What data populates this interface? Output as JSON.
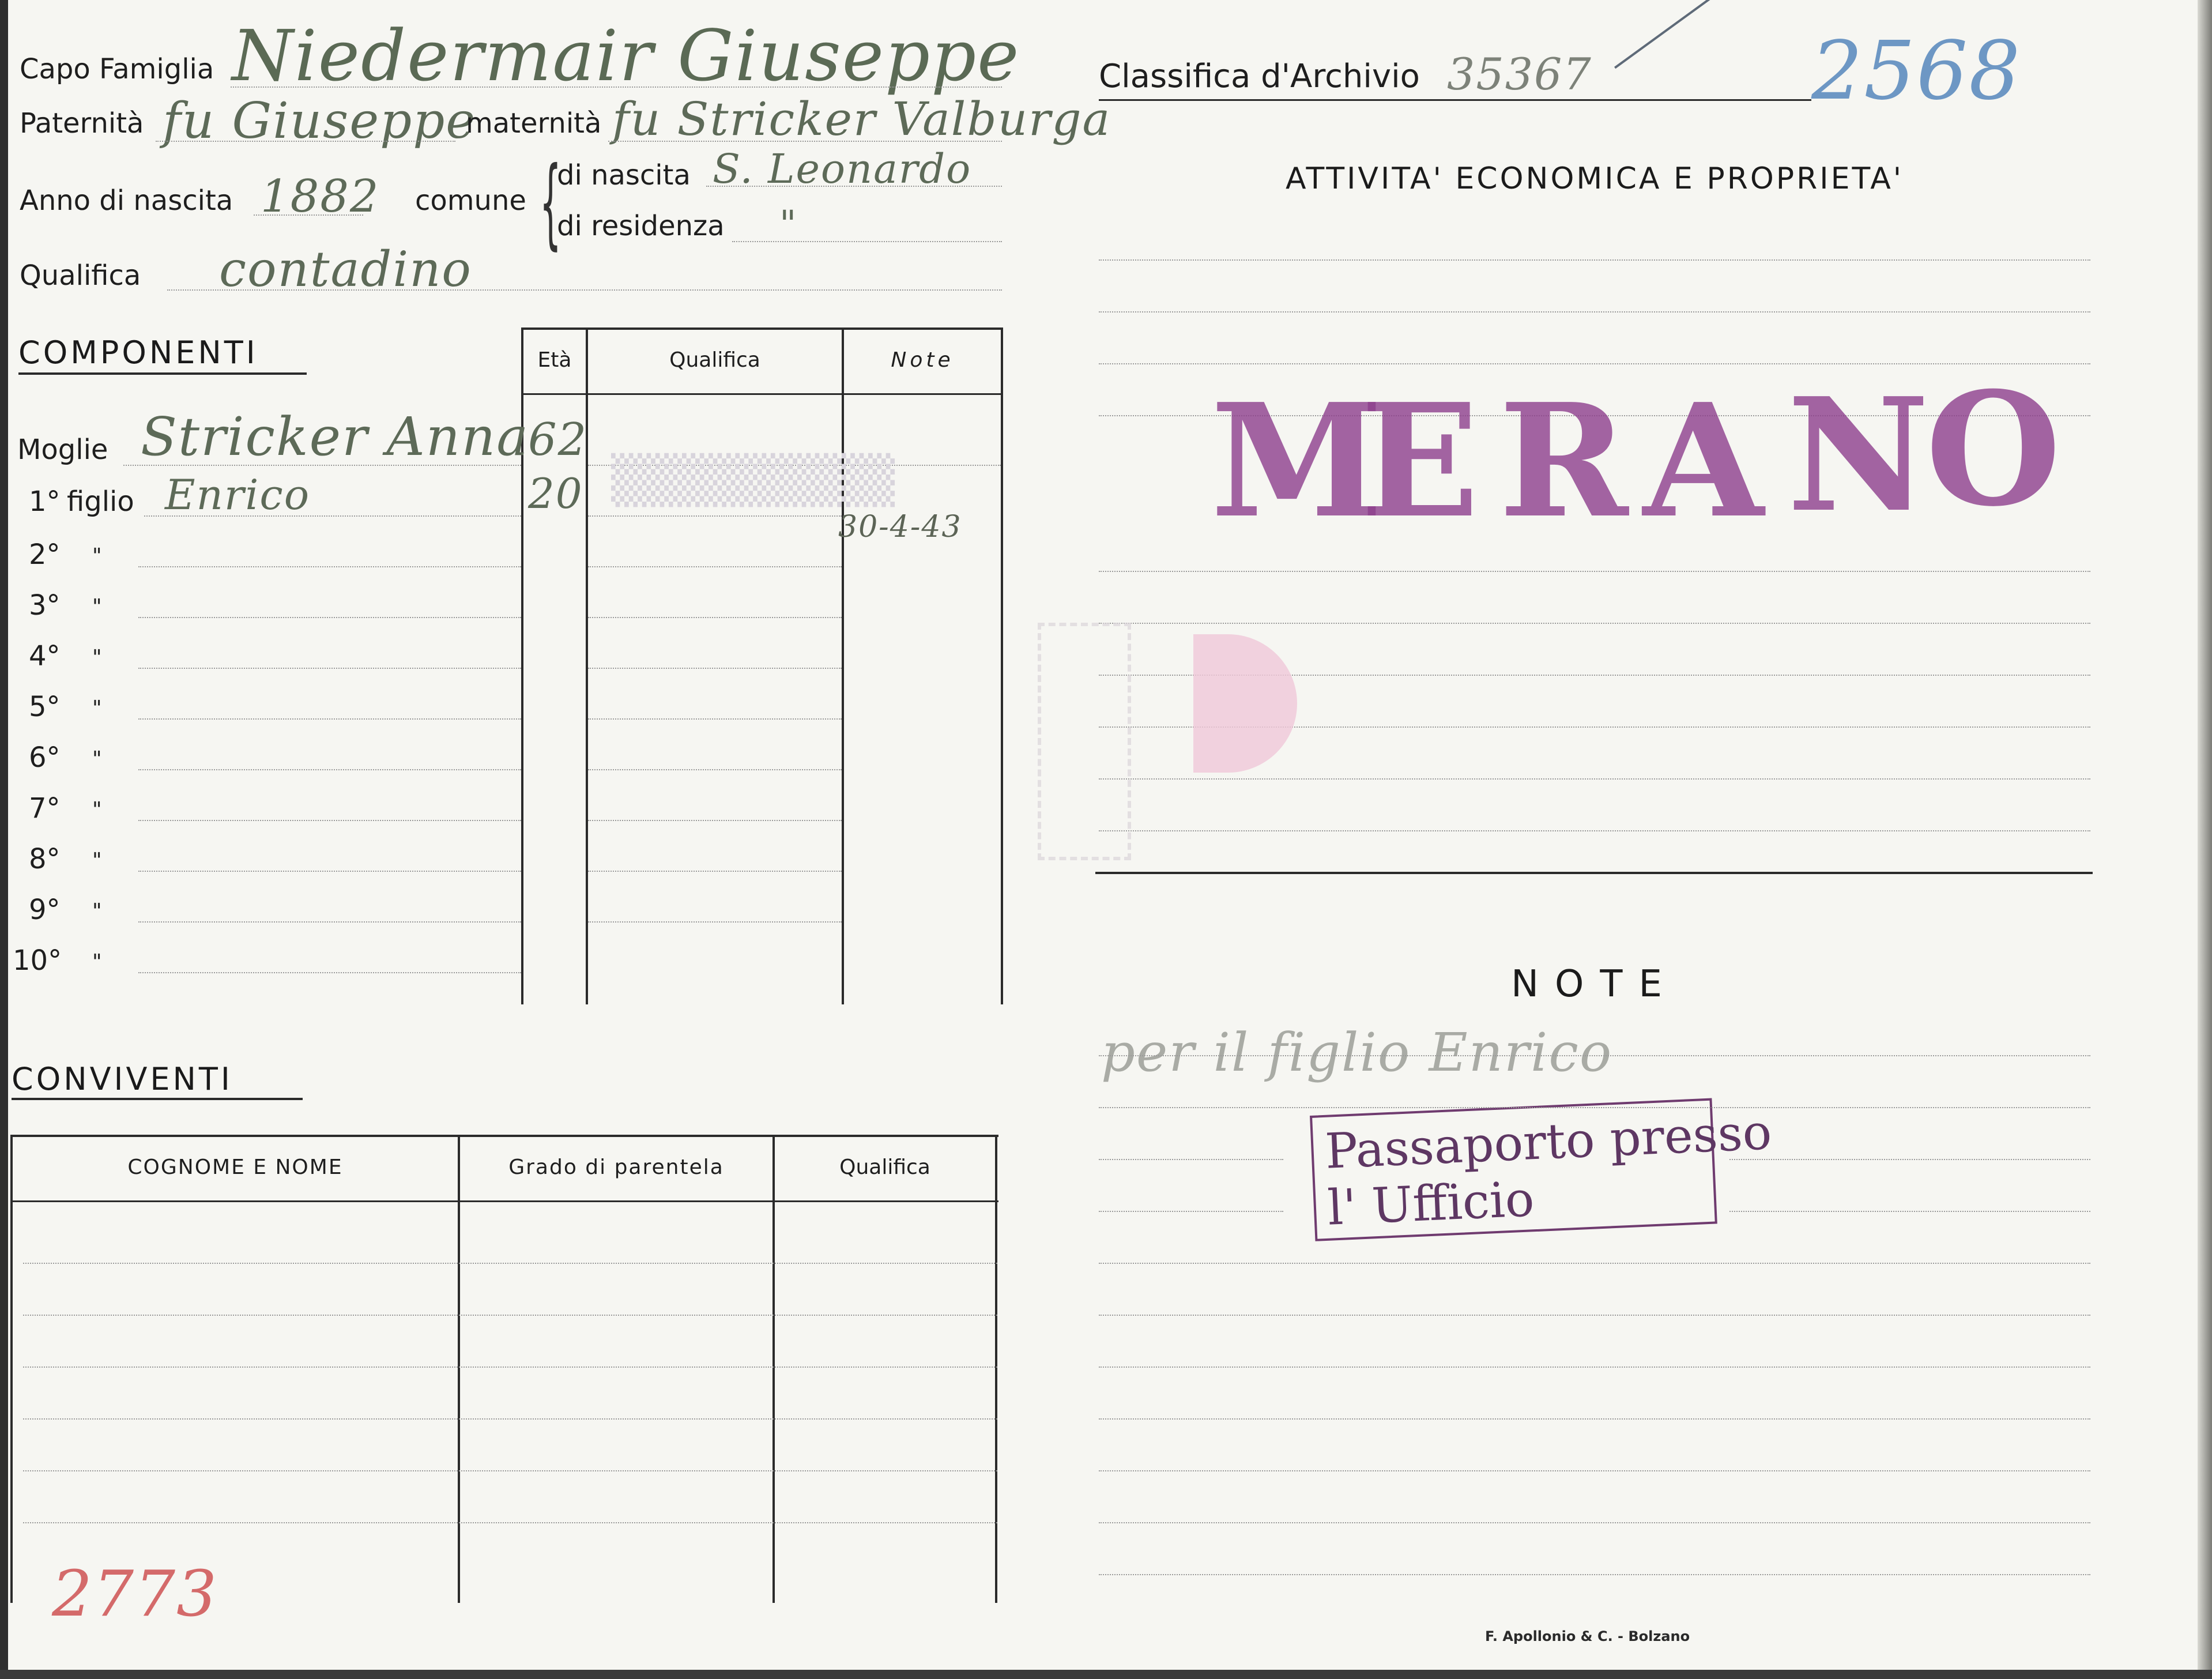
{
  "header": {
    "capo_famiglia_label": "Capo Famiglia",
    "capo_famiglia_value": "Niedermair Giuseppe",
    "paternita_label": "Paternità",
    "paternita_value": "fu Giuseppe",
    "maternita_label": "maternità",
    "maternita_value": "fu Stricker Valburga",
    "anno_label": "Anno di nascita",
    "anno_value": "1882",
    "comune_label": "comune",
    "di_nascita_label": "di nascita",
    "di_nascita_value": "S. Leonardo",
    "di_residenza_label": "di residenza",
    "di_residenza_value": "\"",
    "qualifica_label": "Qualifica",
    "qualifica_value": "contadino"
  },
  "archive": {
    "label": "Classifica d'Archivio",
    "value": "35367",
    "number": "2568"
  },
  "componenti": {
    "title": "COMPONENTI",
    "columns": [
      "Età",
      "Qualifica",
      "Note"
    ],
    "rows": [
      {
        "label": "Moglie",
        "ord": "",
        "name": "Stricker Anna",
        "eta": "62",
        "note": ""
      },
      {
        "label": "figlio",
        "ord": "1°",
        "name": "Enrico",
        "eta": "20",
        "note": "30-4-43"
      },
      {
        "label": "\"",
        "ord": "2°",
        "name": "",
        "eta": "",
        "note": ""
      },
      {
        "label": "\"",
        "ord": "3°",
        "name": "",
        "eta": "",
        "note": ""
      },
      {
        "label": "\"",
        "ord": "4°",
        "name": "",
        "eta": "",
        "note": ""
      },
      {
        "label": "\"",
        "ord": "5°",
        "name": "",
        "eta": "",
        "note": ""
      },
      {
        "label": "\"",
        "ord": "6°",
        "name": "",
        "eta": "",
        "note": ""
      },
      {
        "label": "\"",
        "ord": "7°",
        "name": "",
        "eta": "",
        "note": ""
      },
      {
        "label": "\"",
        "ord": "8°",
        "name": "",
        "eta": "",
        "note": ""
      },
      {
        "label": "\"",
        "ord": "9°",
        "name": "",
        "eta": "",
        "note": ""
      },
      {
        "label": "\"",
        "ord": "10°",
        "name": "",
        "eta": "",
        "note": ""
      }
    ]
  },
  "conviventi": {
    "title": "CONVIVENTI",
    "columns": [
      "COGNOME E NOME",
      "Grado di parentela",
      "Qualifica"
    ]
  },
  "attivita": {
    "title": "ATTIVITA' ECONOMICA E PROPRIETA'"
  },
  "stamp_merano": "MERANO",
  "note": {
    "title": "NOTE",
    "handwritten": "per il figlio Enrico",
    "stamp_line1": "Passaporto presso",
    "stamp_line2": "l' Ufficio"
  },
  "footer": {
    "number": "2773",
    "printer": "F. Apollonio & C. - Bolzano"
  },
  "colors": {
    "paper": "#f6f6f2",
    "stamp_purple": "#8e3f8d",
    "archive_number_blue": "#6d97c4",
    "footer_number_red": "#d46a6a",
    "handwriting": "#5d6a58"
  }
}
